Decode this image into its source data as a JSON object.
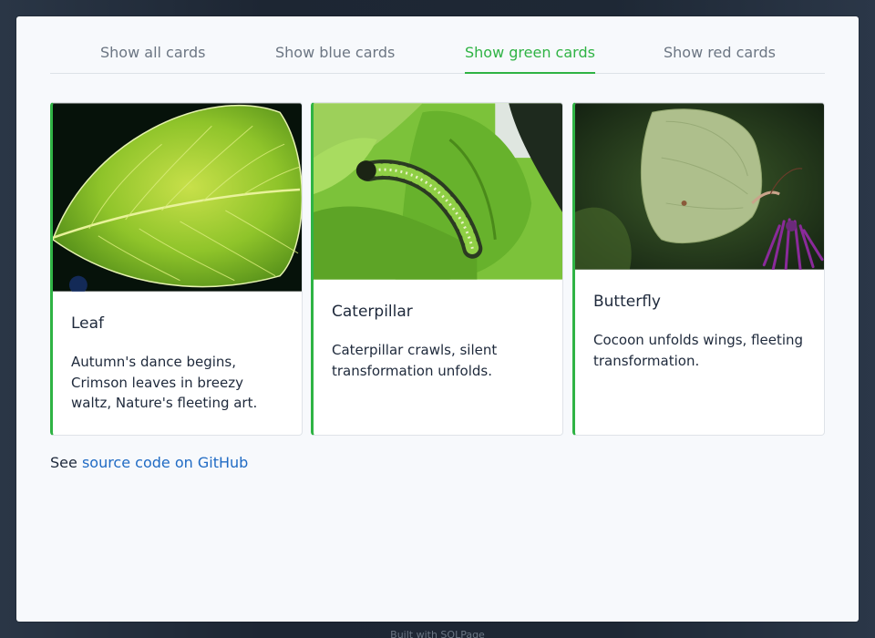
{
  "tabs": [
    {
      "label": "Show all cards",
      "active": false
    },
    {
      "label": "Show blue cards",
      "active": false
    },
    {
      "label": "Show green cards",
      "active": true
    },
    {
      "label": "Show red cards",
      "active": false
    }
  ],
  "cards": [
    {
      "title": "Leaf",
      "text": "Autumn's dance begins, Crimson leaves in breezy waltz, Nature's fleeting art.",
      "border_color": "#2fb344"
    },
    {
      "title": "Caterpillar",
      "text": "Caterpillar crawls, silent transformation unfolds.",
      "border_color": "#2fb344"
    },
    {
      "title": "Butterfly",
      "text": "Cocoon unfolds wings, fleeting transformation.",
      "border_color": "#2fb344"
    }
  ],
  "footer": {
    "prefix": "See",
    "link_text": "source code on GitHub"
  },
  "built_with": "Built with SQLPage",
  "colors": {
    "accent": "#2fb344",
    "link": "#206bc4",
    "tab_inactive": "#6c7683"
  }
}
